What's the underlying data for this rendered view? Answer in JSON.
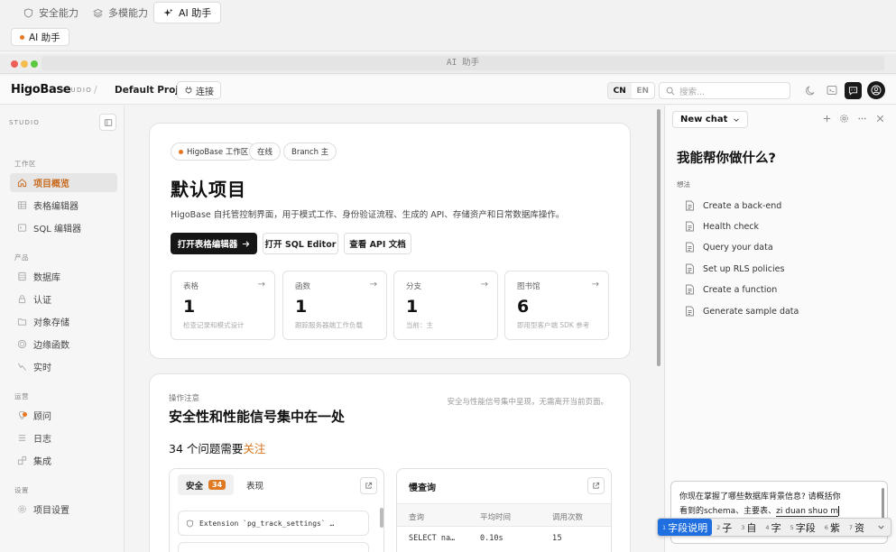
{
  "top_tabs": [
    {
      "label": "安全能力",
      "icon": "shield-icon"
    },
    {
      "label": "多模能力",
      "icon": "layers-icon"
    },
    {
      "label": "AI 助手",
      "icon": "sparkle-icon"
    }
  ],
  "top_pill": {
    "label": "AI 助手"
  },
  "window": {
    "url": "AI 助手"
  },
  "header": {
    "logo": "HigoBase",
    "studio": "STUDIO",
    "separator": "/",
    "project": "Default Project",
    "connect": "连接",
    "lang": [
      "CN",
      "EN"
    ],
    "search_placeholder": "搜索..."
  },
  "sidebar": {
    "studio": "STUDIO",
    "sections": [
      {
        "title": "工作区",
        "items": [
          {
            "label": "项目概览",
            "icon": "home-icon",
            "active": true
          },
          {
            "label": "表格编辑器",
            "icon": "table-icon"
          },
          {
            "label": "SQL 编辑器",
            "icon": "terminal-icon"
          }
        ]
      },
      {
        "title": "产品",
        "items": [
          {
            "label": "数据库",
            "icon": "database-icon"
          },
          {
            "label": "认证",
            "icon": "lock-icon"
          },
          {
            "label": "对象存储",
            "icon": "folder-icon"
          },
          {
            "label": "边缘函数",
            "icon": "globe-icon"
          },
          {
            "label": "实时",
            "icon": "pulse-icon"
          }
        ]
      },
      {
        "title": "运营",
        "items": [
          {
            "label": "顾问",
            "icon": "lightbulb-icon"
          },
          {
            "label": "日志",
            "icon": "list-icon"
          },
          {
            "label": "集成",
            "icon": "puzzle-icon"
          }
        ]
      },
      {
        "title": "设置",
        "items": [
          {
            "label": "项目设置",
            "icon": "gear-icon"
          }
        ]
      }
    ]
  },
  "overview": {
    "badges": [
      "HigoBase 工作区",
      "在线",
      "Branch 主"
    ],
    "title": "默认项目",
    "description": "HigoBase 自托管控制界面，用于模式工作、身份验证流程、生成的 API、存储资产和日常数据库操作。",
    "buttons": {
      "table_editor": "打开表格编辑器",
      "sql_editor": "打开 SQL Editor",
      "api_docs": "查看 API 文档"
    },
    "stats": [
      {
        "label": "表格",
        "value": "1",
        "sub": "检查记录和模式设计"
      },
      {
        "label": "函数",
        "value": "1",
        "sub": "跟踪服务器端工作负载"
      },
      {
        "label": "分支",
        "value": "1",
        "sub": "当前：主"
      },
      {
        "label": "图书馆",
        "value": "6",
        "sub": "即用型客户端 SDK 参考"
      }
    ]
  },
  "ops": {
    "label": "操作注意",
    "right_note": "安全与性能信号集中呈现，无需离开当前页面。",
    "title": "安全性和性能信号集中在一处",
    "issues_prefix": "34 个问题需要",
    "issues_accent": "关注",
    "security_tab": "安全",
    "security_count": "34",
    "perf_tab": "表现",
    "ext_row": "Extension `pg_track_settings` …",
    "slow_title": "慢查询",
    "slow_headers": [
      "查询",
      "平均时间",
      "调用次数"
    ],
    "slow_rows": [
      [
        "SELECT na…",
        "0.10s",
        "15"
      ]
    ]
  },
  "chat": {
    "new_chat": "New chat",
    "title": "我能帮你做什么?",
    "ideas_label": "想法",
    "suggestions": [
      "Create a back-end",
      "Health check",
      "Query your data",
      "Set up RLS policies",
      "Create a function",
      "Generate sample data"
    ],
    "input_line1": "你现在掌握了哪些数据库背景信息? 请概括你",
    "input_line2_prefix": "看到的schema、主要表、",
    "input_line2_composing": "zi duan shuo m"
  },
  "ime": {
    "candidates": [
      {
        "n": "1",
        "text": "字段说明"
      },
      {
        "n": "2",
        "text": "子"
      },
      {
        "n": "3",
        "text": "自"
      },
      {
        "n": "4",
        "text": "字"
      },
      {
        "n": "5",
        "text": "字段"
      },
      {
        "n": "6",
        "text": "紫"
      },
      {
        "n": "7",
        "text": "资"
      }
    ]
  },
  "colors": {
    "accent": "#d5731c",
    "dark": "#161616",
    "ime_select": "#1f6fe0"
  }
}
